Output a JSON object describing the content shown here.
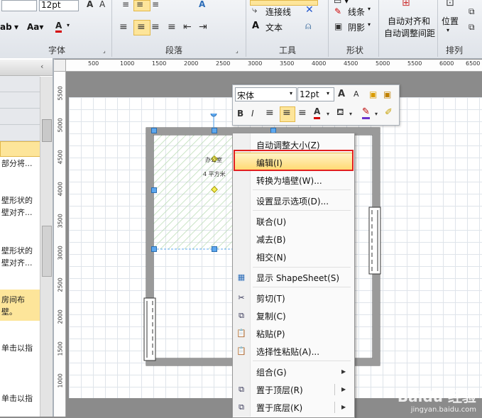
{
  "ribbon": {
    "font_size": "12pt",
    "groups": {
      "font": "字体",
      "paragraph": "段落",
      "tools": "工具",
      "shape": "形状",
      "arrange": "排列"
    },
    "tools": {
      "connector": "连接线",
      "text": "文本"
    },
    "shape": {
      "line": "线条",
      "shadow": "阴影"
    },
    "arrange": {
      "auto_align_line1": "自动对齐和",
      "auto_align_line2": "自动调整间距",
      "position": "位置"
    }
  },
  "left_panel": {
    "texts": [
      "部分将...",
      "壁形状的\n壁对齐...",
      "壁形状的\n壁对齐...",
      "房间布\n壁。",
      "单击以指",
      "单击以指"
    ]
  },
  "ruler_top": [
    "500",
    "1000",
    "1500",
    "2000",
    "2500",
    "3000",
    "3500",
    "4000",
    "4500",
    "5000",
    "5500",
    "6000",
    "6500"
  ],
  "ruler_left": [
    "5500",
    "5000",
    "4500",
    "4000",
    "3500",
    "3000",
    "2500",
    "2000",
    "1500",
    "1000"
  ],
  "room": {
    "name": "办公室",
    "area": "4 平方米"
  },
  "mini_toolbar": {
    "font": "宋体",
    "size": "12pt",
    "bold": "B",
    "italic": "I"
  },
  "context_menu": {
    "items": [
      {
        "label": "自动调整大小(Z)"
      },
      {
        "label": "编辑(I)"
      },
      {
        "label": "转换为墙壁(W)..."
      },
      {
        "label": "设置显示选项(D)..."
      },
      {
        "label": "联合(U)"
      },
      {
        "label": "减去(B)"
      },
      {
        "label": "相交(N)"
      },
      {
        "label": "显示 ShapeSheet(S)"
      },
      {
        "label": "剪切(T)"
      },
      {
        "label": "复制(C)"
      },
      {
        "label": "粘贴(P)"
      },
      {
        "label": "选择性粘贴(A)..."
      },
      {
        "label": "组合(G)"
      },
      {
        "label": "置于顶层(R)"
      },
      {
        "label": "置于底层(K)"
      }
    ]
  },
  "colors": {
    "accent": "#fde59a",
    "highlight_border": "#e21f1f",
    "font_red": "#d40000"
  },
  "watermark": {
    "brand": "Baidu 经验",
    "url": "jingyan.baidu.com"
  }
}
